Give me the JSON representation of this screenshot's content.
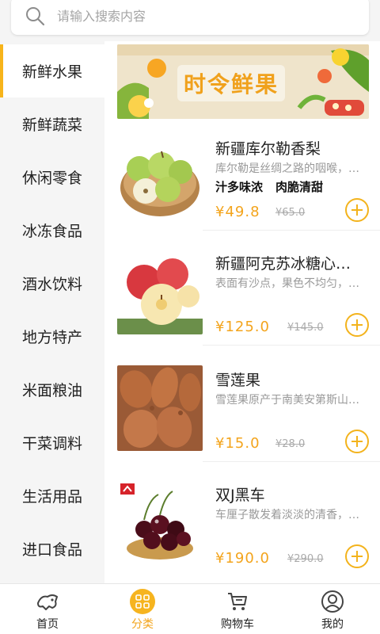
{
  "search": {
    "placeholder": "请输入搜索内容"
  },
  "sidebar": {
    "items": [
      {
        "label": "新鲜水果",
        "active": true
      },
      {
        "label": "新鲜蔬菜"
      },
      {
        "label": "休闲零食"
      },
      {
        "label": "冰冻食品"
      },
      {
        "label": "酒水饮料"
      },
      {
        "label": "地方特产"
      },
      {
        "label": "米面粮油"
      },
      {
        "label": "干菜调料"
      },
      {
        "label": "生活用品"
      },
      {
        "label": "进口食品"
      }
    ]
  },
  "banner": {
    "title": "时令鲜果"
  },
  "products": [
    {
      "name": "新疆库尔勒香梨",
      "desc": "库尔勒是丝绸之路的咽喉，…",
      "tags": [
        "汁多味浓",
        "肉脆清甜"
      ],
      "price": "¥49.8",
      "old_price": "¥65.0"
    },
    {
      "name": "新疆阿克苏冰糖心…",
      "desc": "表面有沙点，果色不均匀，…",
      "tags": [],
      "price": "¥125.0",
      "old_price": "¥145.0"
    },
    {
      "name": "雪莲果",
      "desc": "雪莲果原产于南美安第斯山…",
      "tags": [],
      "price": "¥15.0",
      "old_price": "¥28.0"
    },
    {
      "name": "双J黑车",
      "desc": "车厘子散发着淡淡的清香，…",
      "tags": [],
      "price": "¥190.0",
      "old_price": "¥290.0"
    }
  ],
  "tabbar": {
    "items": [
      {
        "label": "首页",
        "icon": "home-icon"
      },
      {
        "label": "分类",
        "icon": "category-icon",
        "active": true
      },
      {
        "label": "购物车",
        "icon": "cart-icon"
      },
      {
        "label": "我的",
        "icon": "user-icon"
      }
    ]
  },
  "colors": {
    "accent": "#f3a41c",
    "sidebar_bg": "#f5f5f5",
    "active_bar": "#f7b41b"
  }
}
